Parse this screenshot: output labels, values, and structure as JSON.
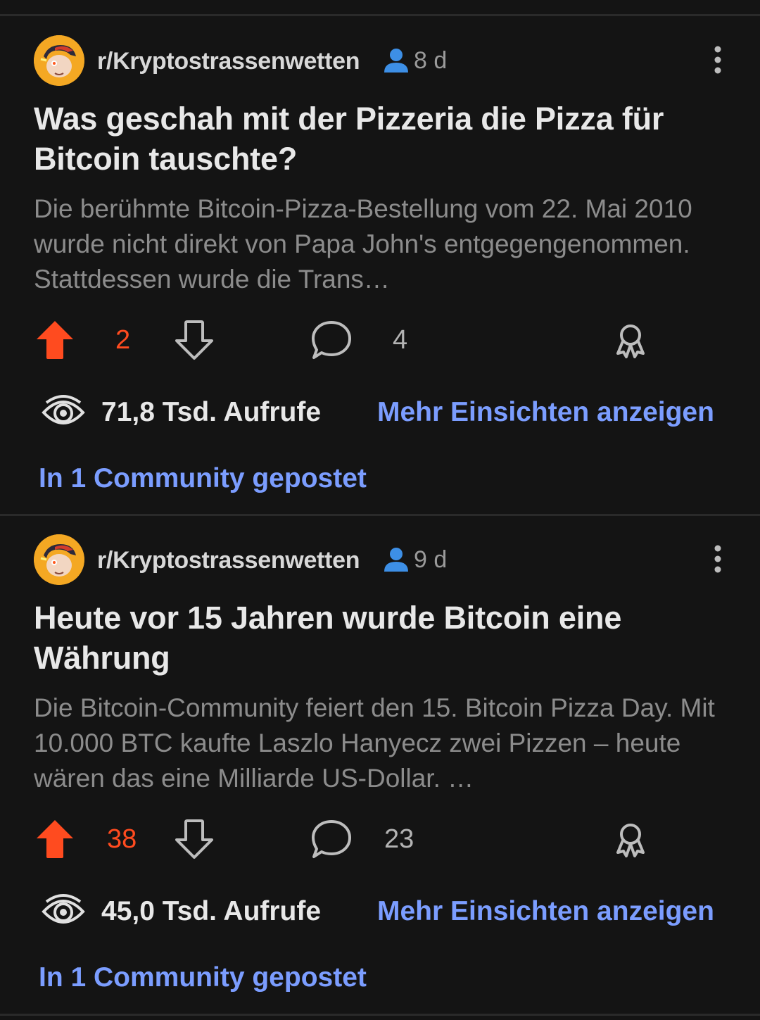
{
  "posts": [
    {
      "subreddit": "r/Kryptostrassenwetten",
      "age": "8 d",
      "title": "Was geschah mit der Pizzeria die Pizza für Bitcoin tauschte?",
      "body": "Die berühmte Bitcoin-Pizza-Bestellung vom 22. Mai 2010 wurde nicht direkt von Papa John's entgegengenommen. Stattdessen wurde die Trans…",
      "upvotes": "2",
      "comments": "4",
      "views": "71,8 Tsd. Aufrufe",
      "insights_link": "Mehr Einsichten anzeigen",
      "posted_in": "In 1 Community gepostet"
    },
    {
      "subreddit": "r/Kryptostrassenwetten",
      "age": "9 d",
      "title": "Heute vor 15 Jahren wurde Bitcoin eine Währung",
      "body": "Die Bitcoin-Community feiert den 15. Bitcoin Pizza Day. Mit 10.000 BTC kaufte Laszlo Hanyecz zwei Pizzen – heute wären das eine Milliarde US-Dollar. …",
      "upvotes": "38",
      "comments": "23",
      "views": "45,0 Tsd. Aufrufe",
      "insights_link": "Mehr Einsichten anzeigen",
      "posted_in": "In 1 Community gepostet"
    }
  ],
  "colors": {
    "background": "#141414",
    "upvote_active": "#ff4b1f",
    "link_blue": "#7b9dff",
    "person_icon": "#3d8fe6",
    "avatar_bg": "#f4a823"
  },
  "icons": [
    "subreddit-avatar",
    "user-icon",
    "more-options-icon",
    "upvote-icon",
    "downvote-icon",
    "comment-icon",
    "award-icon",
    "views-eye-icon"
  ]
}
